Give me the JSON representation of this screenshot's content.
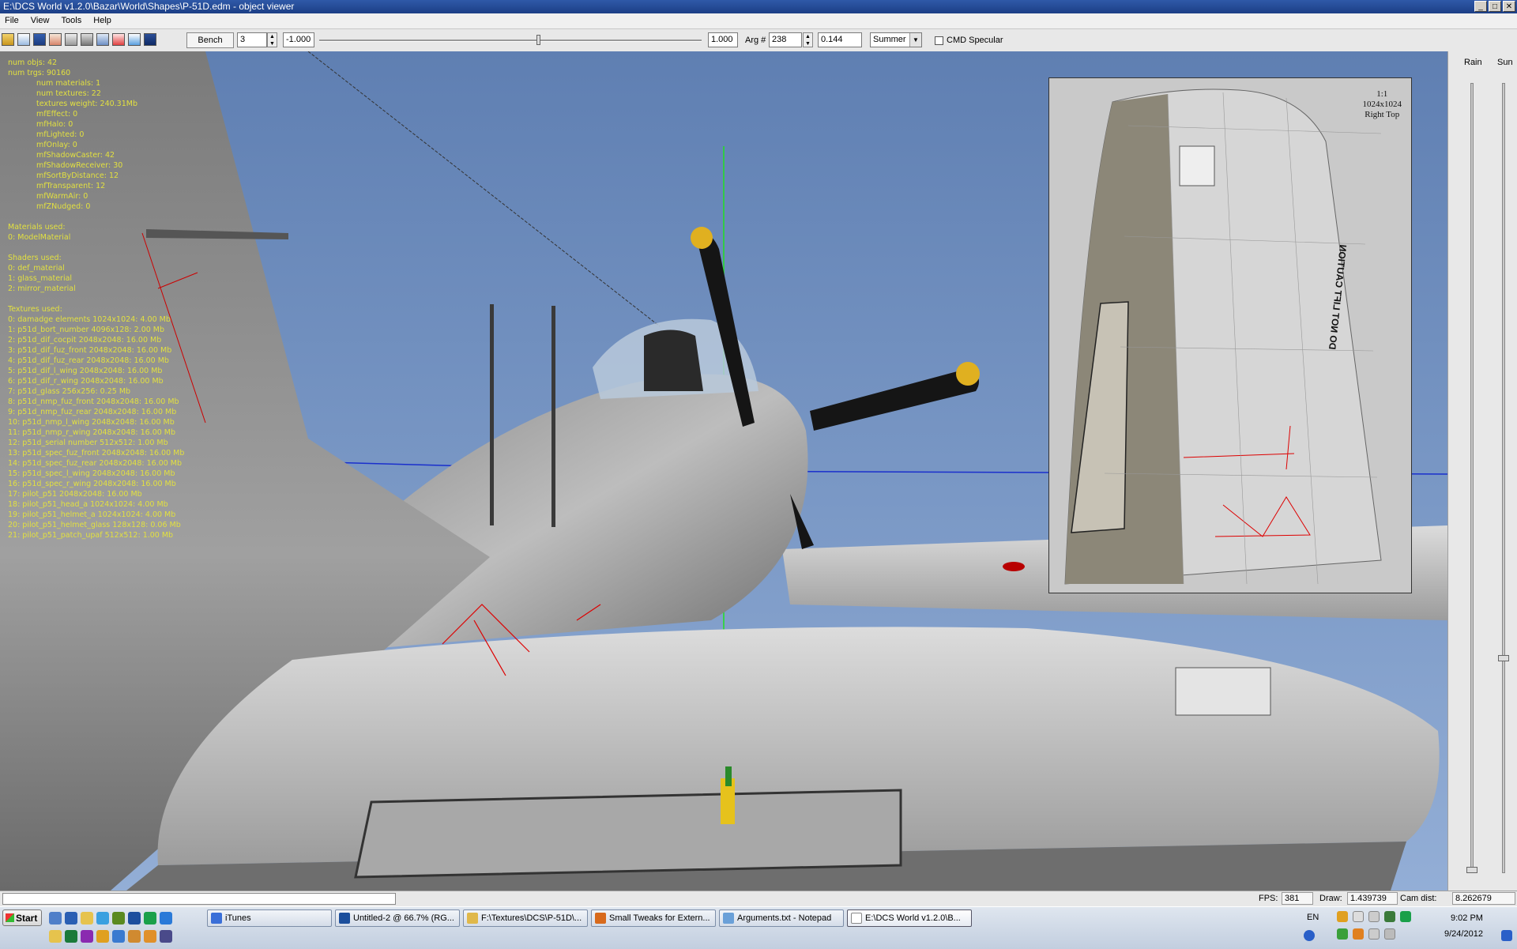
{
  "window": {
    "title": "E:\\DCS World v1.2.0\\Bazar\\World\\Shapes\\P-51D.edm - object viewer",
    "controls": [
      "_",
      "□",
      "✕"
    ]
  },
  "menu": [
    "File",
    "View",
    "Tools",
    "Help"
  ],
  "toolbar": {
    "bench_label": "Bench",
    "bench_value": "3",
    "slider_value": "-1.000",
    "slider_right_value": "1.000",
    "arg_label": "Arg #",
    "arg_value": "238",
    "arg_result": "0.144",
    "season": "Summer",
    "cmd_specular_label": "CMD Specular",
    "cmd_specular_checked": false
  },
  "info": {
    "stats": [
      "num objs: 42",
      "num trgs: 90160"
    ],
    "flags": [
      "num materials: 1",
      "num textures: 22",
      "textures weight: 240.31Mb",
      "mfEffect: 0",
      "mfHalo: 0",
      "mfLighted: 0",
      "mfOnlay: 0",
      "mfShadowCaster: 42",
      "mfShadowReceiver: 30",
      "mfSortByDistance: 12",
      "mfTransparent: 12",
      "mfWarmAir: 0",
      "mfZNudged: 0"
    ],
    "materials_header": "Materials used:",
    "materials": [
      "0: ModelMaterial"
    ],
    "shaders_header": "Shaders used:",
    "shaders": [
      "0: def_material",
      "1: glass_material",
      "2: mirror_material"
    ],
    "textures_header": "Textures used:",
    "textures": [
      "0: damadge elements 1024x1024: 4.00 Mb",
      "1: p51d_bort_number 4096x128: 2.00 Mb",
      "2: p51d_dif_cocpit 2048x2048: 16.00 Mb",
      "3: p51d_dif_fuz_front 2048x2048: 16.00 Mb",
      "4: p51d_dif_fuz_rear 2048x2048: 16.00 Mb",
      "5: p51d_dif_l_wing 2048x2048: 16.00 Mb",
      "6: p51d_dif_r_wing 2048x2048: 16.00 Mb",
      "7: p51d_glass 256x256: 0.25 Mb",
      "8: p51d_nmp_fuz_front 2048x2048: 16.00 Mb",
      "9: p51d_nmp_fuz_rear 2048x2048: 16.00 Mb",
      "10: p51d_nmp_l_wing 2048x2048: 16.00 Mb",
      "11: p51d_nmp_r_wing 2048x2048: 16.00 Mb",
      "12: p51d_serial number 512x512: 1.00 Mb",
      "13: p51d_spec_fuz_front 2048x2048: 16.00 Mb",
      "14: p51d_spec_fuz_rear 2048x2048: 16.00 Mb",
      "15: p51d_spec_l_wing 2048x2048: 16.00 Mb",
      "16: p51d_spec_r_wing 2048x2048: 16.00 Mb",
      "17: pilot_p51 2048x2048: 16.00 Mb",
      "18: pilot_p51_head_a 1024x1024: 4.00 Mb",
      "19: pilot_p51_helmet_a 1024x1024: 4.00 Mb",
      "20: pilot_p51_helmet_glass 128x128: 0.06 Mb",
      "21: pilot_p51_patch_upaf 512x512: 1.00 Mb"
    ]
  },
  "inset": {
    "line1": "1:1",
    "line2": "1024x1024",
    "line3": "Right Top",
    "stencil": "DO NOT LIFT CAUTION"
  },
  "side": {
    "rain_label": "Rain",
    "sun_label": "Sun",
    "rain_level": 0.0,
    "sun_level": 0.27
  },
  "status": {
    "fps_label": "FPS:",
    "fps": "381",
    "draw_label": "Draw:",
    "draw": "1.439739",
    "camdist_label": "Cam dist:",
    "camdist": "8.262679"
  },
  "taskbar": {
    "start": "Start",
    "tasks": [
      {
        "label": "iTunes",
        "color": "#3a6fd8"
      },
      {
        "label": "Untitled-2 @ 66.7% (RG...",
        "color": "#1c4f9c"
      },
      {
        "label": "F:\\Textures\\DCS\\P-51D\\...",
        "color": "#e0b84a"
      },
      {
        "label": "Small Tweaks for Extern...",
        "color": "#d86a1c"
      },
      {
        "label": "Arguments.txt - Notepad",
        "color": "#6aa0d8"
      },
      {
        "label": "E:\\DCS World v1.2.0\\B...",
        "color": "#ffffff"
      }
    ],
    "lang": "EN",
    "time": "9:02 PM",
    "date": "9/24/2012"
  }
}
